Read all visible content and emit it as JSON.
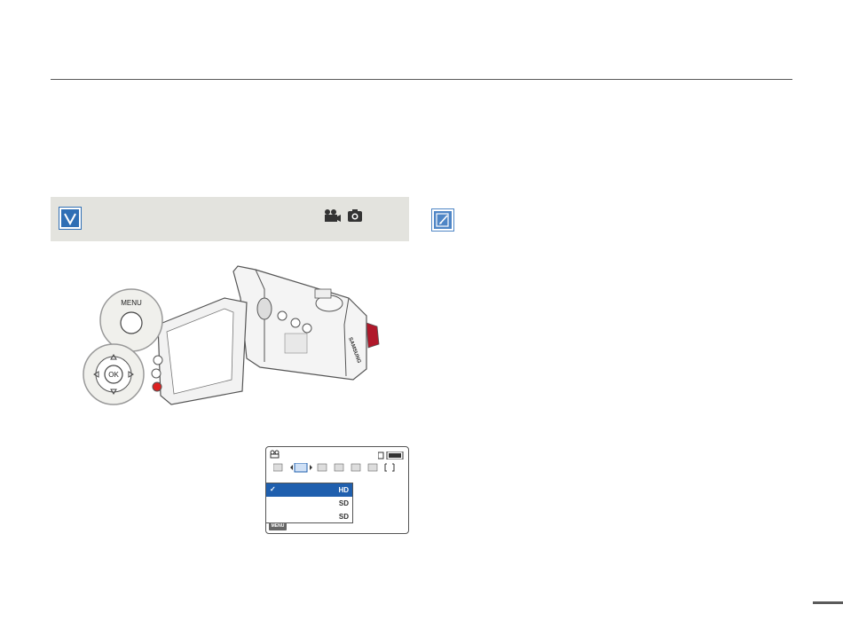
{
  "camera": {
    "menu_label": "MENU",
    "ok_label": "OK",
    "brand_label": "SAMSUNG"
  },
  "lcd": {
    "menu_button": "MENU",
    "options": [
      {
        "value": "HD",
        "selected": true
      },
      {
        "value": "SD",
        "selected": false
      },
      {
        "value": "SD",
        "selected": false
      }
    ]
  },
  "colors": {
    "accent_blue": "#2f6fb5",
    "selected_row": "#1f5fae",
    "callout_bg": "#e3e3de"
  },
  "icons": {
    "check": "checkbox-icon",
    "note": "note-pencil-icon",
    "video_mode": "video-camera-icon",
    "photo_mode": "photo-camera-icon"
  }
}
